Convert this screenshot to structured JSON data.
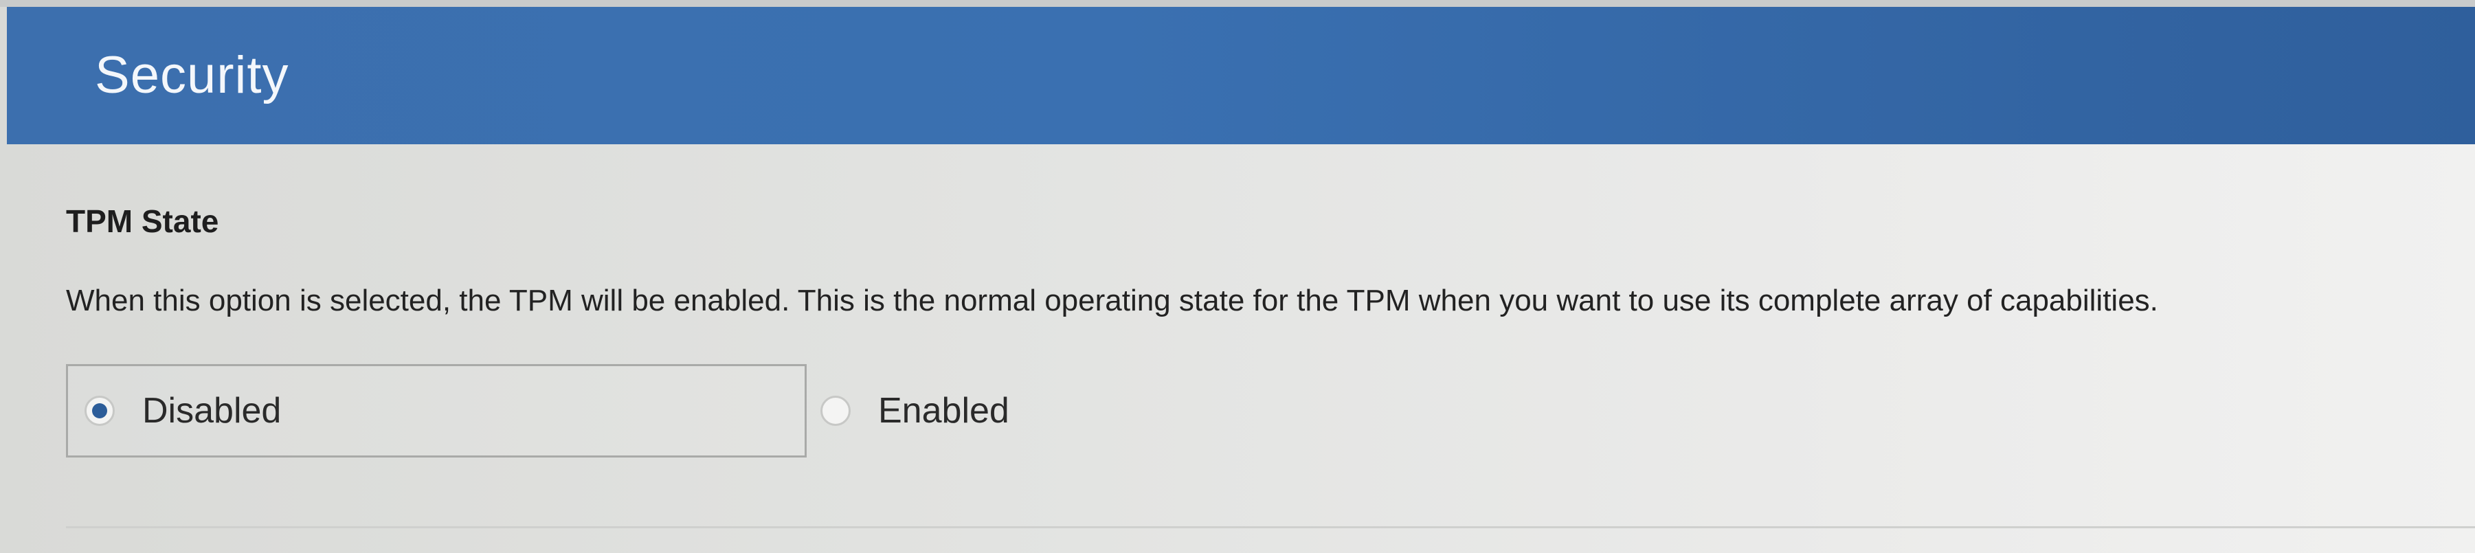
{
  "header": {
    "title": "Security"
  },
  "setting": {
    "title": "TPM State",
    "description": "When this option is selected, the TPM will be enabled. This is the normal operating state for the TPM when you want to use its complete array of capabilities.",
    "options": [
      {
        "label": "Disabled",
        "selected": true
      },
      {
        "label": "Enabled",
        "selected": false
      }
    ]
  },
  "colors": {
    "header_bg": "#3a70b1",
    "header_text": "#f4f7fb",
    "radio_selected": "#2c5d99"
  }
}
